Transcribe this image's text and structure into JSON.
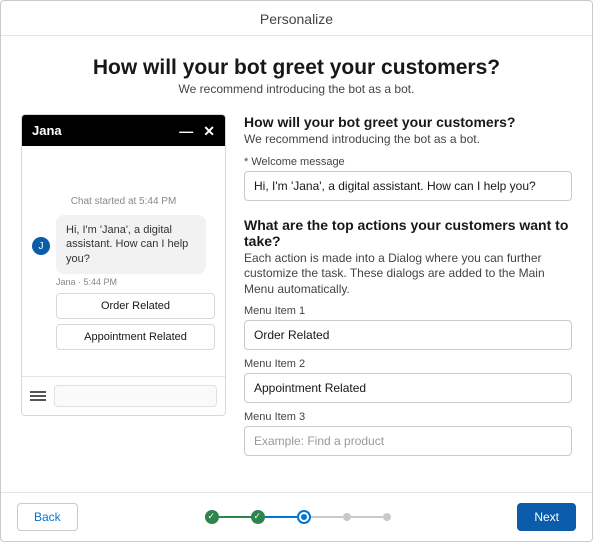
{
  "header": {
    "title": "Personalize"
  },
  "hero": {
    "title": "How will your bot greet your customers?",
    "subtitle": "We recommend introducing the bot as a bot."
  },
  "preview": {
    "botName": "Jana",
    "chatStarted": "Chat started at 5:44 PM",
    "bubble": "Hi, I'm 'Jana', a digital assistant. How can I help you?",
    "meta": "Jana · 5:44 PM",
    "menu1": "Order Related",
    "menu2": "Appointment Related",
    "avatarLetter": "J"
  },
  "form": {
    "greeting": {
      "title": "How will your bot greet your customers?",
      "subtitle": "We recommend introducing the bot as a bot.",
      "welcomeLabel": "Welcome message",
      "welcomeValue": "Hi, I'm 'Jana', a digital assistant. How can I help you?"
    },
    "actions": {
      "title": "What are the top actions your customers want to take?",
      "subtitle": "Each action is made into a Dialog where you can further customize the task. These dialogs are added to the Main Menu automatically.",
      "item1Label": "Menu Item 1",
      "item1Value": "Order Related",
      "item2Label": "Menu Item 2",
      "item2Value": "Appointment Related",
      "item3Label": "Menu Item 3",
      "item3Placeholder": "Example: Find a product"
    }
  },
  "footer": {
    "back": "Back",
    "next": "Next"
  }
}
